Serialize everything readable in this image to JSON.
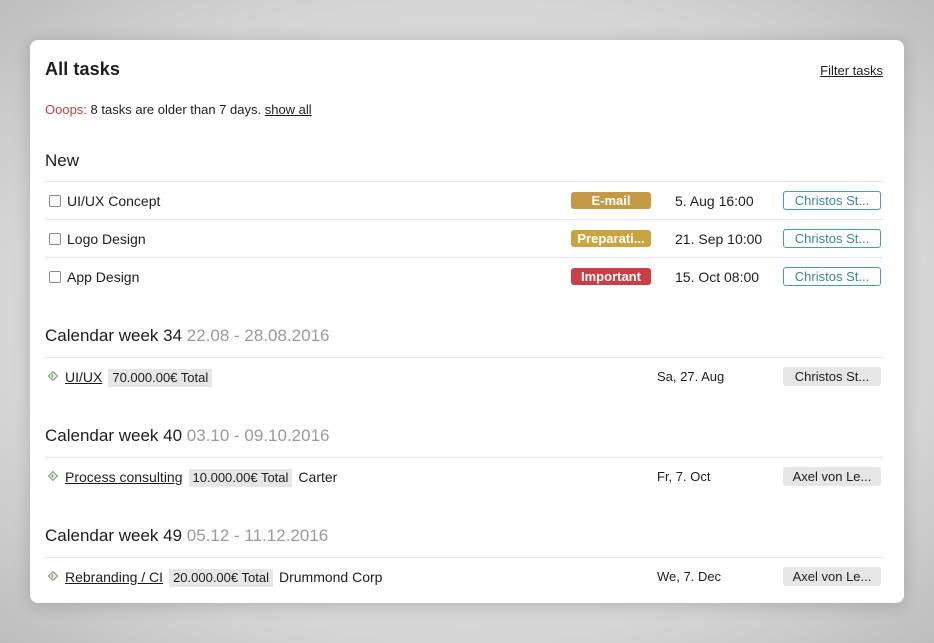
{
  "header": {
    "title": "All tasks",
    "filter_label": "Filter tasks"
  },
  "alert": {
    "prefix": "Ooops:",
    "message": "8 tasks are older than 7 days.",
    "link": "show all"
  },
  "new_section": {
    "title": "New",
    "tasks": [
      {
        "name": "UI/UX Concept",
        "tag": "E-mail",
        "tag_color": "#c49a45",
        "due": "5. Aug  16:00",
        "assignee": "Christos St..."
      },
      {
        "name": "Logo Design",
        "tag": "Preparati...",
        "tag_color": "#c8a53e",
        "due": "21. Sep  10:00",
        "assignee": "Christos St..."
      },
      {
        "name": "App Design",
        "tag": "Important",
        "tag_color": "#cc3d46",
        "due": "15. Oct  08:00",
        "assignee": "Christos St..."
      }
    ]
  },
  "weeks": [
    {
      "title": "Calendar week 34",
      "range": "22.08 - 28.08.2016",
      "project": "UI/UX",
      "amount": "70.000.00€ Total",
      "client": "",
      "date": "Sa, 27. Aug",
      "assignee": "Christos St..."
    },
    {
      "title": "Calendar week 40",
      "range": "03.10 - 09.10.2016",
      "project": "Process consulting",
      "amount": "10.000.00€ Total",
      "client": "Carter",
      "date": "Fr, 7. Oct",
      "assignee": "Axel von Le..."
    },
    {
      "title": "Calendar week 49",
      "range": "05.12 - 11.12.2016",
      "project": "Rebranding / CI",
      "amount": "20.000.00€ Total",
      "client": "Drummond Corp",
      "date": "We, 7. Dec",
      "assignee": "Axel von Le..."
    }
  ],
  "colors": {
    "alert": "#c1403d",
    "assignee_outline": "#4e9aa8",
    "range_text": "#9a9a9a"
  }
}
